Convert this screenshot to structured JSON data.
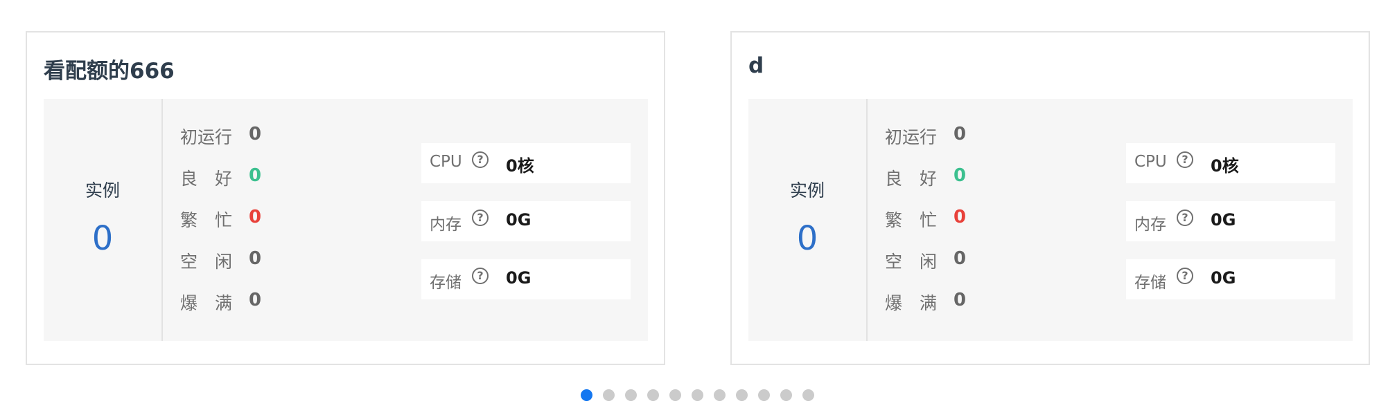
{
  "cards": [
    {
      "title": "看配额的666",
      "instance_label": "实例",
      "instance_count": "0",
      "statuses": [
        {
          "label": "初运行",
          "value": "0",
          "color": "#666666"
        },
        {
          "label": "良　好",
          "value": "0",
          "color": "#3cc08f"
        },
        {
          "label": "繁　忙",
          "value": "0",
          "color": "#e8413a"
        },
        {
          "label": "空　闲",
          "value": "0",
          "color": "#666666"
        },
        {
          "label": "爆　满",
          "value": "0",
          "color": "#666666"
        }
      ],
      "resources": [
        {
          "label": "CPU",
          "value": "0核",
          "icon": "help-circle-icon"
        },
        {
          "label": "内存",
          "value": "0G",
          "icon": "help-circle-icon"
        },
        {
          "label": "存储",
          "value": "0G",
          "icon": "help-circle-icon"
        }
      ]
    },
    {
      "title": "d",
      "instance_label": "实例",
      "instance_count": "0",
      "statuses": [
        {
          "label": "初运行",
          "value": "0",
          "color": "#666666"
        },
        {
          "label": "良　好",
          "value": "0",
          "color": "#3cc08f"
        },
        {
          "label": "繁　忙",
          "value": "0",
          "color": "#e8413a"
        },
        {
          "label": "空　闲",
          "value": "0",
          "color": "#666666"
        },
        {
          "label": "爆　满",
          "value": "0",
          "color": "#666666"
        }
      ],
      "resources": [
        {
          "label": "CPU",
          "value": "0核",
          "icon": "help-circle-icon"
        },
        {
          "label": "内存",
          "value": "0G",
          "icon": "help-circle-icon"
        },
        {
          "label": "存储",
          "value": "0G",
          "icon": "help-circle-icon"
        }
      ]
    }
  ],
  "pagination": {
    "count": 11,
    "active": 0
  },
  "colors": {
    "accent": "#1477f0",
    "instance": "#2d6fc8",
    "good": "#3cc08f",
    "busy": "#e8413a"
  }
}
